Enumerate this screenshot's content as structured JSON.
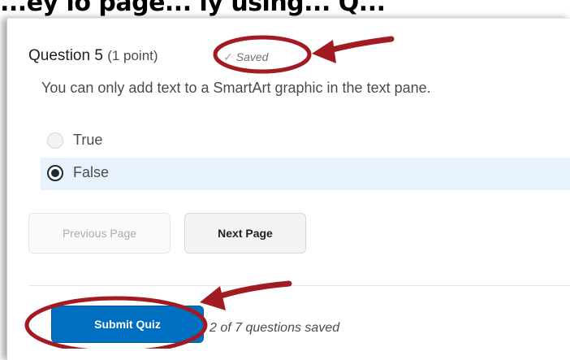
{
  "caption": {
    "text": "...ey lo page... ly using... Q..."
  },
  "question": {
    "title": "Question 5",
    "points": "(1 point)",
    "saved_label": "Saved",
    "text": "You can only add text to a SmartArt graphic in the text pane.",
    "options": [
      {
        "label": "True",
        "selected": false
      },
      {
        "label": "False",
        "selected": true
      }
    ]
  },
  "nav": {
    "previous_label": "Previous Page",
    "next_label": "Next Page"
  },
  "footer": {
    "submit_label": "Submit Quiz",
    "saved_status": "2 of 7 questions saved"
  },
  "colors": {
    "annotation": "#a31b22",
    "submit": "#006fbf",
    "selected_row": "#e8f2fc"
  },
  "icons": {
    "saved": "checkmark-icon",
    "annotation": "arrow-icon"
  }
}
